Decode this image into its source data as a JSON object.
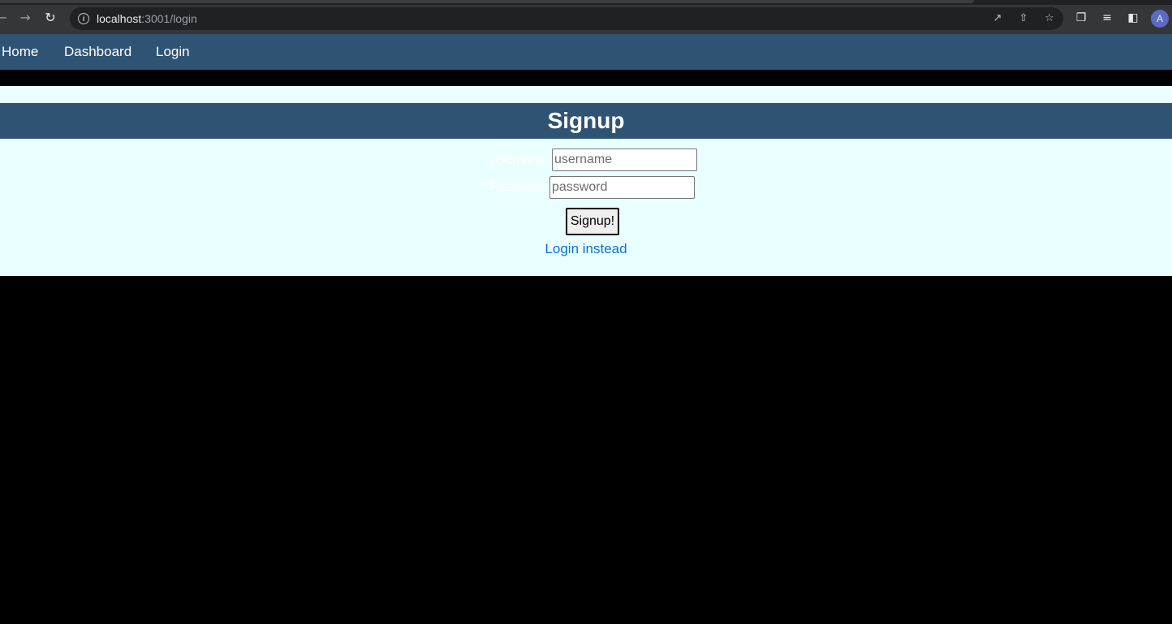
{
  "browser": {
    "url_host": "localhost",
    "url_path": ":3001/login",
    "back_icon": "arrow-left-icon",
    "forward_icon": "arrow-right-icon",
    "reload_icon": "reload-icon",
    "profile_initial": "A"
  },
  "nav": {
    "items": [
      {
        "label": "Home"
      },
      {
        "label": "Dashboard"
      },
      {
        "label": "Login"
      }
    ]
  },
  "signup": {
    "title": "Signup",
    "username_label": "Username",
    "username_placeholder": "username",
    "password_label": "Password",
    "password_placeholder": "password",
    "submit_label": "Signup!",
    "alt_link": "Login instead"
  },
  "colors": {
    "nav_bg": "#2f5373",
    "panel_bg": "#eaffff",
    "link": "#0a72d8",
    "page_bg": "#000000"
  }
}
